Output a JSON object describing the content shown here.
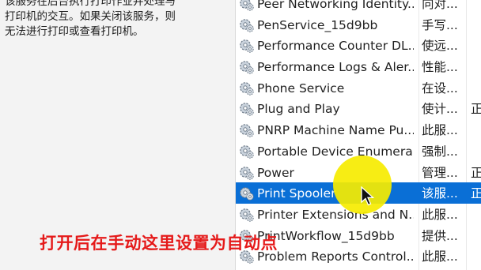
{
  "description_panel": {
    "lines": [
      "该服务在后台执行打印作业并处理与",
      "打印机的交互。如果关闭该服务，则",
      "无法进行打印或查看打印机。"
    ]
  },
  "services": [
    {
      "name": "Peer Networking Identity...",
      "description": "向对...",
      "status": "",
      "selected": false
    },
    {
      "name": "PenService_15d9bb",
      "description": "手写...",
      "status": "",
      "selected": false
    },
    {
      "name": "Performance Counter DL...",
      "description": "使远...",
      "status": "",
      "selected": false
    },
    {
      "name": "Performance Logs & Aler...",
      "description": "性能...",
      "status": "",
      "selected": false
    },
    {
      "name": "Phone Service",
      "description": "在设...",
      "status": "",
      "selected": false
    },
    {
      "name": "Plug and Play",
      "description": "使计...",
      "status": "正",
      "selected": false
    },
    {
      "name": "PNRP Machine Name Pu...",
      "description": "此服...",
      "status": "",
      "selected": false
    },
    {
      "name": "Portable Device Enumera...",
      "description": "强制...",
      "status": "",
      "selected": false
    },
    {
      "name": "Power",
      "description": "管理...",
      "status": "正",
      "selected": false
    },
    {
      "name": "Print Spooler",
      "description": "该服...",
      "status": "正",
      "selected": true
    },
    {
      "name": "Printer Extensions and N...",
      "description": "此服...",
      "status": "",
      "selected": false
    },
    {
      "name": "PrintWorkflow_15d9bb",
      "description": "提供...",
      "status": "",
      "selected": false
    },
    {
      "name": "Problem Reports Control...",
      "description": "此服...",
      "status": "",
      "selected": false
    }
  ],
  "caption": "打开后在手动这里设置为自动点",
  "colors": {
    "selection": "#0a6fd6",
    "caption": "#e51a1a",
    "highlight": "#f6ec00"
  },
  "icons": {
    "service": "gear-icon",
    "pointer": "mouse-cursor-icon"
  }
}
